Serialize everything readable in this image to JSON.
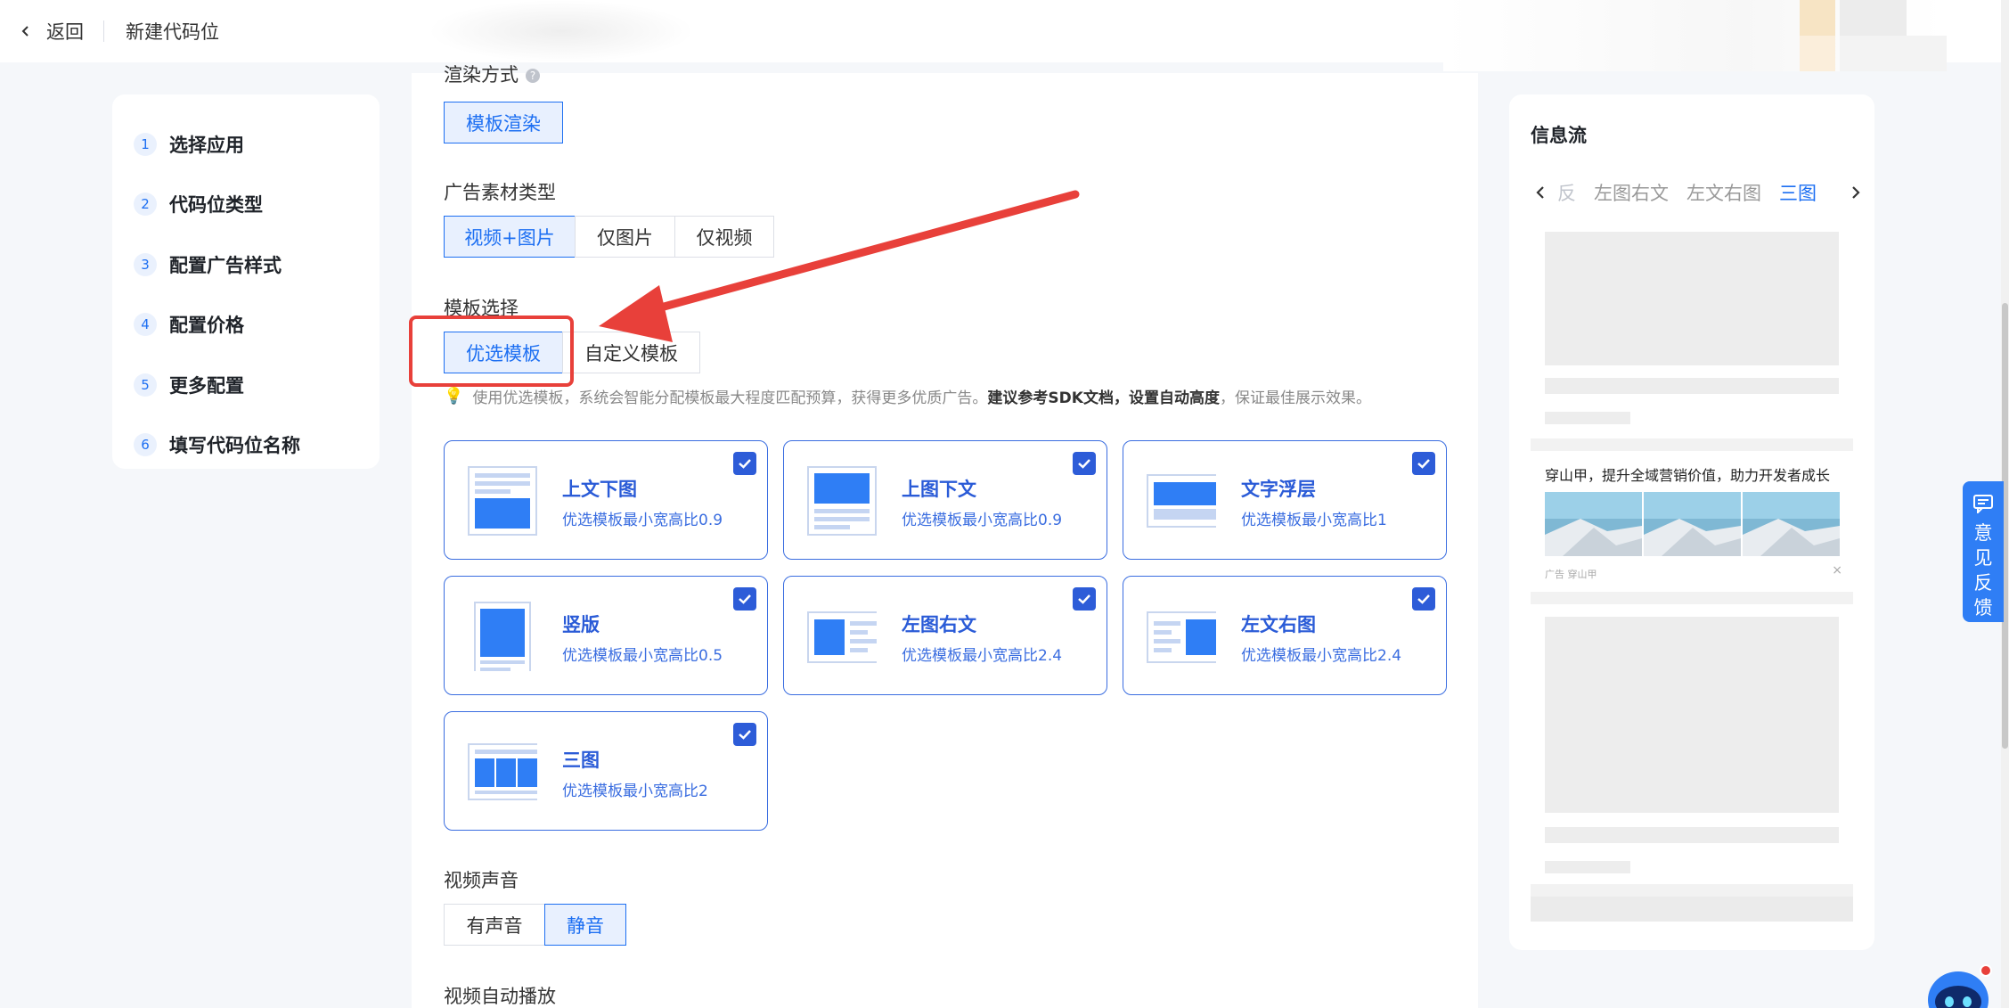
{
  "topbar": {
    "back_label": "返回",
    "title": "新建代码位"
  },
  "steps": [
    {
      "num": "1",
      "label": "选择应用"
    },
    {
      "num": "2",
      "label": "代码位类型"
    },
    {
      "num": "3",
      "label": "配置广告样式"
    },
    {
      "num": "4",
      "label": "配置价格"
    },
    {
      "num": "5",
      "label": "更多配置"
    },
    {
      "num": "6",
      "label": "填写代码位名称"
    }
  ],
  "render": {
    "label": "渲染方式",
    "option": "模板渲染"
  },
  "material": {
    "label": "广告素材类型",
    "options": [
      "视频+图片",
      "仅图片",
      "仅视频"
    ],
    "selected": "视频+图片"
  },
  "template_choice": {
    "label": "模板选择",
    "options": [
      "优选模板",
      "自定义模板"
    ],
    "selected": "优选模板"
  },
  "tip": {
    "text_a": "使用优选模板，系统会智能分配模板最大程度匹配预算，获得更多优质广告。",
    "text_bold": "建议参考SDK文档，设置自动高度",
    "text_b": "，保证最佳展示效果。"
  },
  "templates": [
    {
      "title": "上文下图",
      "sub": "优选模板最小宽高比0.9",
      "icon": "text-top-image-bottom-icon",
      "checked": true
    },
    {
      "title": "上图下文",
      "sub": "优选模板最小宽高比0.9",
      "icon": "image-top-text-bottom-icon",
      "checked": true
    },
    {
      "title": "文字浮层",
      "sub": "优选模板最小宽高比1",
      "icon": "text-overlay-icon",
      "checked": true
    },
    {
      "title": "竖版",
      "sub": "优选模板最小宽高比0.5",
      "icon": "vertical-icon",
      "checked": true
    },
    {
      "title": "左图右文",
      "sub": "优选模板最小宽高比2.4",
      "icon": "image-left-text-right-icon",
      "checked": true
    },
    {
      "title": "左文右图",
      "sub": "优选模板最小宽高比2.4",
      "icon": "text-left-image-right-icon",
      "checked": true
    },
    {
      "title": "三图",
      "sub": "优选模板最小宽高比2",
      "icon": "three-images-icon",
      "checked": true
    }
  ],
  "video_sound": {
    "label": "视频声音",
    "options": [
      "有声音",
      "静音"
    ],
    "selected": "静音"
  },
  "video_autoplay": {
    "label": "视频自动播放"
  },
  "preview": {
    "title": "信息流",
    "tabs": [
      "反",
      "左图右文",
      "左文右图",
      "三图"
    ],
    "active_tab": "三图",
    "feed_title": "穿山甲，提升全域营销价值，助力开发者成长",
    "feed_footer": "广告 穿山甲",
    "feed_close": "×"
  },
  "feedback": {
    "label": "意见反馈"
  },
  "colors": {
    "primary": "#1d6ff2",
    "card_border": "#3a6de0",
    "annotation": "#e8403a"
  }
}
